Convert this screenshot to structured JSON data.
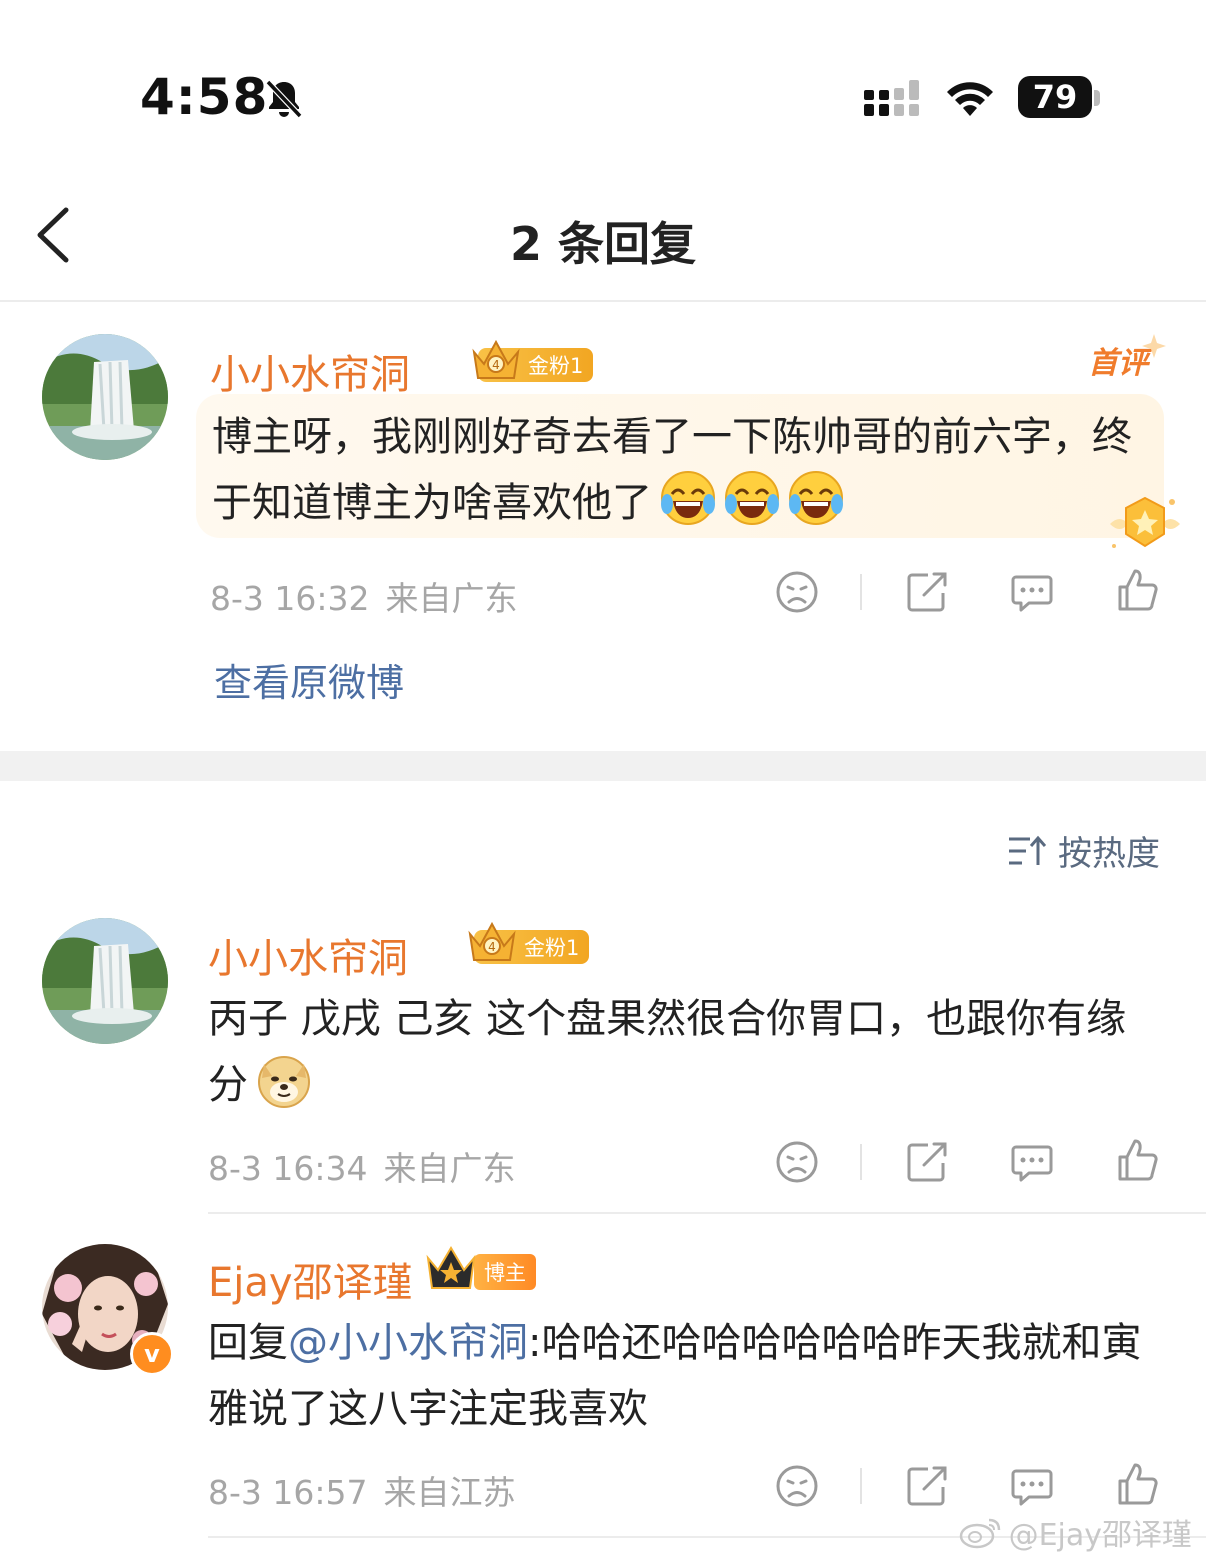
{
  "status_bar": {
    "time": "4:58",
    "battery": "79"
  },
  "nav": {
    "title": "2 条回复"
  },
  "root_comment": {
    "username": "小小水帘洞",
    "badge": "金粉1",
    "first_comment_tag": "首评",
    "text": "博主呀，我刚刚好奇去看了一下陈帅哥的前六字，终于知道博主为啥喜欢他了",
    "emojis": [
      "laugh-cry",
      "laugh-cry",
      "laugh-cry"
    ],
    "time": "8-3 16:32",
    "location": "来自广东",
    "view_original": "查看原微博"
  },
  "sort": {
    "label": "按热度"
  },
  "replies": [
    {
      "username": "小小水帘洞",
      "badge": "金粉1",
      "text": "丙子 戊戌 己亥 这个盘果然很合你胃口，也跟你有缘分",
      "emoji": "doge",
      "time": "8-3 16:34",
      "location": "来自广东"
    },
    {
      "username": "Ejay邵译瑾",
      "badge": "博主",
      "reply_prefix": "回复",
      "mention": "@小小水帘洞",
      "text": ":哈哈还哈哈哈哈哈哈昨天我就和寅雅说了这八字注定我喜欢",
      "time": "8-3 16:57",
      "location": "来自江苏"
    }
  ],
  "watermark": "@Ejay邵译瑾",
  "colors": {
    "username": "#e8772e",
    "link": "#4d6fa3",
    "meta": "#a6a6a6",
    "badge_gold": "#f2a622"
  }
}
